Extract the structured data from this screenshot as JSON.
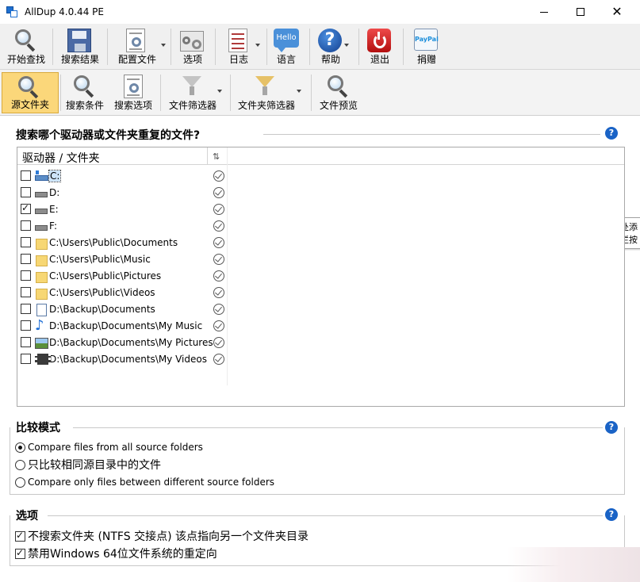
{
  "window": {
    "title": "AllDup 4.0.44 PE"
  },
  "toolbar_main": [
    {
      "label": "开始查找"
    },
    {
      "label": "搜索结果"
    },
    {
      "label": "配置文件"
    },
    {
      "label": "选项"
    },
    {
      "label": "日志"
    },
    {
      "label": "语言",
      "icon_text": "Hello"
    },
    {
      "label": "帮助",
      "icon_text": "?"
    },
    {
      "label": "退出"
    },
    {
      "label": "捐赠",
      "icon_text_a": "Pay",
      "icon_text_b": "Pal"
    }
  ],
  "toolbar_sub": [
    {
      "label": "源文件夹",
      "active": true
    },
    {
      "label": "搜索条件"
    },
    {
      "label": "搜索选项"
    },
    {
      "label": "文件筛选器"
    },
    {
      "label": "文件夹筛选器"
    },
    {
      "label": "文件预览"
    }
  ],
  "tooltip": {
    "line1": "右键单击此处添",
    "line2": "或点击工具栏按"
  },
  "source_section": {
    "title": "搜索哪个驱动器或文件夹重复的文件?",
    "help": "?",
    "column_header": "驱动器 / 文件夹",
    "column_icon": "⇅",
    "rows": [
      {
        "label": "C:",
        "checked": false,
        "icon": "drive-c-icon"
      },
      {
        "label": "D:",
        "checked": false,
        "icon": "drive-icon"
      },
      {
        "label": "E:",
        "checked": true,
        "icon": "drive-icon"
      },
      {
        "label": "F:",
        "checked": false,
        "icon": "drive-icon"
      },
      {
        "label": "C:\\Users\\Public\\Documents",
        "checked": false,
        "icon": "folder-icon"
      },
      {
        "label": "C:\\Users\\Public\\Music",
        "checked": false,
        "icon": "folder-icon"
      },
      {
        "label": "C:\\Users\\Public\\Pictures",
        "checked": false,
        "icon": "folder-icon"
      },
      {
        "label": "C:\\Users\\Public\\Videos",
        "checked": false,
        "icon": "folder-icon"
      },
      {
        "label": "D:\\Backup\\Documents",
        "checked": false,
        "icon": "file-icon"
      },
      {
        "label": "D:\\Backup\\Documents\\My Music",
        "checked": false,
        "icon": "music-icon"
      },
      {
        "label": "D:\\Backup\\Documents\\My Pictures",
        "checked": false,
        "icon": "picture-icon"
      },
      {
        "label": "D:\\Backup\\Documents\\My Videos",
        "checked": false,
        "icon": "video-icon"
      }
    ]
  },
  "compare_section": {
    "title": "比较模式",
    "help": "?",
    "options": [
      {
        "label": "Compare files from all source folders",
        "selected": true
      },
      {
        "label": "只比较相同源目录中的文件",
        "selected": false
      },
      {
        "label": "Compare only files between different source folders",
        "selected": false
      }
    ]
  },
  "options_section": {
    "title": "选项",
    "help": "?",
    "options": [
      {
        "label": "不搜索文件夹 (NTFS 交接点) 该点指向另一个文件夹目录",
        "checked": true
      },
      {
        "label": "禁用Windows 64位文件系统的重定向",
        "checked": true
      }
    ]
  }
}
